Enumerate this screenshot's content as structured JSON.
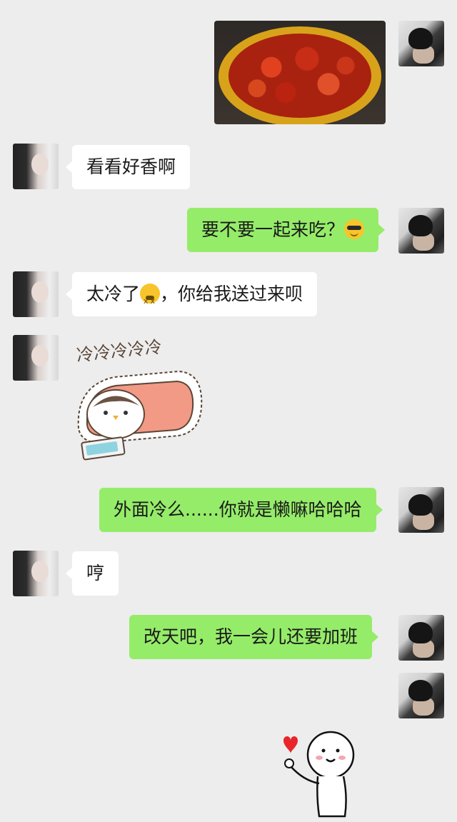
{
  "messages": [
    {
      "sender": "me",
      "type": "image",
      "alt": "crawfish"
    },
    {
      "sender": "friend",
      "type": "text",
      "text": "看看好香啊"
    },
    {
      "sender": "me",
      "type": "text",
      "text": "要不要一起来吃？",
      "emoji": "smiling-sunglasses"
    },
    {
      "sender": "friend",
      "type": "text",
      "text_before": "太冷了",
      "emoji": "cold-face",
      "text_after": "，你给我送过来呗"
    },
    {
      "sender": "friend",
      "type": "sticker",
      "caption": "冷冷冷冷冷"
    },
    {
      "sender": "me",
      "type": "text",
      "text": "外面冷么......你就是懒嘛哈哈哈"
    },
    {
      "sender": "friend",
      "type": "text",
      "text": "哼"
    },
    {
      "sender": "me",
      "type": "text",
      "text": "改天吧，我一会儿还要加班"
    },
    {
      "sender": "me",
      "type": "sticker",
      "alt": "stickman-heart"
    }
  ],
  "colors": {
    "background": "#ededed",
    "my_bubble": "#95ec69",
    "friend_bubble": "#ffffff",
    "text": "#191919"
  }
}
